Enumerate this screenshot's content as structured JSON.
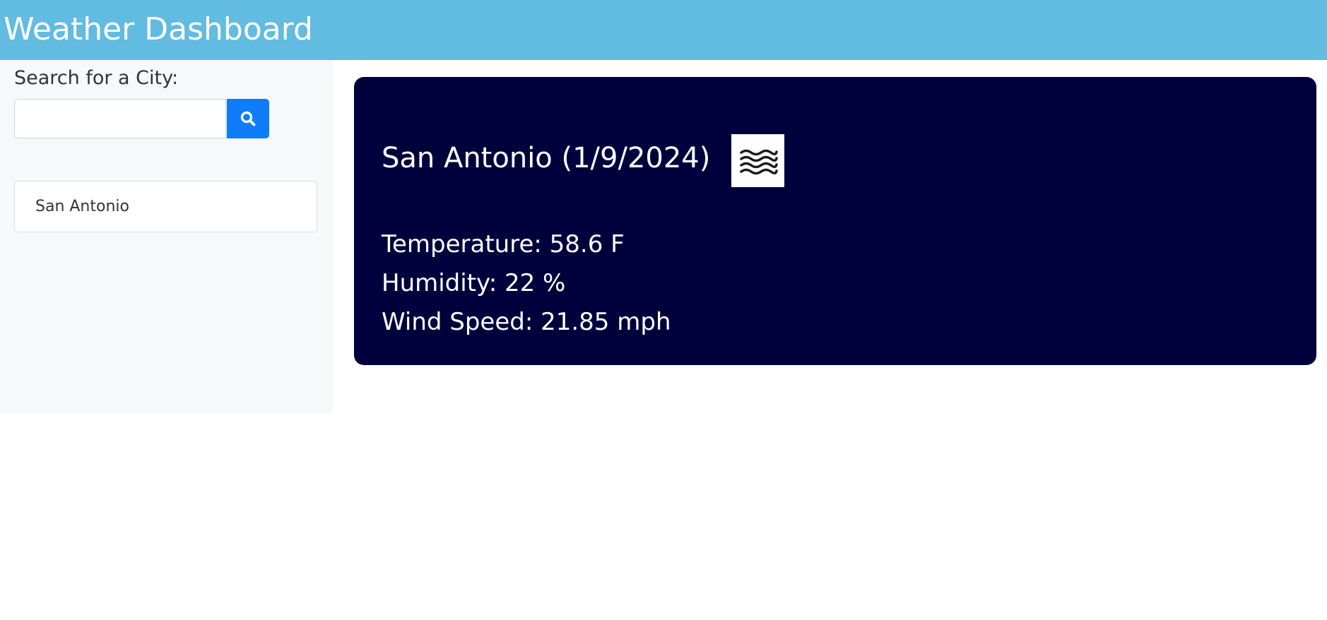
{
  "header": {
    "title": "Weather Dashboard"
  },
  "search": {
    "label": "Search for a City:",
    "value": "",
    "placeholder": "",
    "button_icon": "search-icon"
  },
  "history": {
    "items": [
      {
        "label": "San Antonio"
      }
    ]
  },
  "current": {
    "heading": "San Antonio (1/9/2024)",
    "icon": "mist-icon",
    "temperature": "Temperature: 58.6 F",
    "humidity": "Humidity: 22 %",
    "wind": "Wind Speed: 21.85 mph"
  },
  "colors": {
    "header_bg": "#62bbe0",
    "card_bg": "#00003c",
    "button_bg": "#0d7dfa",
    "sidebar_bg": "#f7f8fa"
  }
}
